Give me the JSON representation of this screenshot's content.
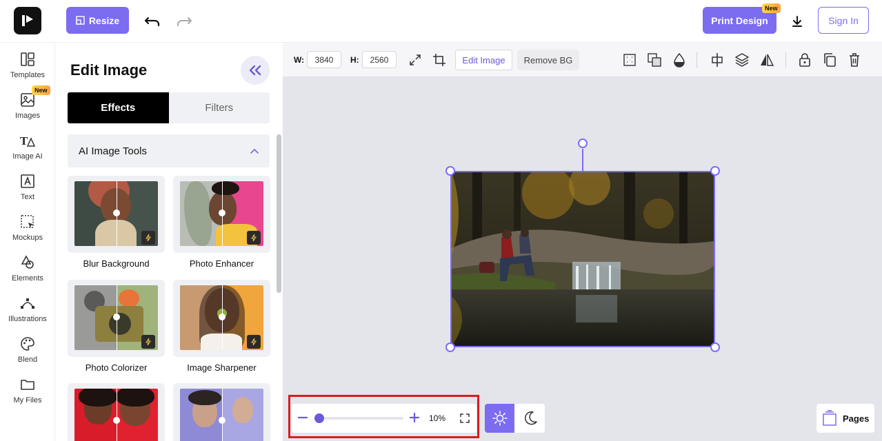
{
  "header": {
    "logo_icon": "brand-logo-icon",
    "resize_label": "Resize",
    "undo_icon": "undo-icon",
    "redo_icon": "redo-icon",
    "print_label": "Print Design",
    "print_badge": "New",
    "download_icon": "download-icon",
    "signin_label": "Sign In",
    "accent_color": "#7c6cf0"
  },
  "rail": {
    "items": [
      {
        "label": "Templates",
        "icon": "templates-icon"
      },
      {
        "label": "Images",
        "icon": "image-icon"
      },
      {
        "label": "Image AI",
        "icon": "image-ai-icon",
        "badge": "New"
      },
      {
        "label": "Text",
        "icon": "text-icon"
      },
      {
        "label": "Mockups",
        "icon": "mockups-icon"
      },
      {
        "label": "Elements",
        "icon": "elements-icon"
      },
      {
        "label": "Illustrations",
        "icon": "illustrations-icon"
      },
      {
        "label": "Blend",
        "icon": "palette-icon"
      },
      {
        "label": "My Files",
        "icon": "folder-icon"
      }
    ]
  },
  "panel": {
    "title": "Edit Image",
    "tabs": [
      {
        "label": "Effects",
        "active": true
      },
      {
        "label": "Filters",
        "active": false
      }
    ],
    "section_title": "AI Image Tools",
    "tools": [
      {
        "label": "Blur Background"
      },
      {
        "label": "Photo Enhancer"
      },
      {
        "label": "Photo Colorizer"
      },
      {
        "label": "Image Sharpener"
      },
      {
        "label": ""
      },
      {
        "label": ""
      }
    ]
  },
  "toolbar": {
    "width_label": "W:",
    "width_value": "3840",
    "height_label": "H:",
    "height_value": "2560",
    "edit_image_label": "Edit Image",
    "remove_bg_label": "Remove BG"
  },
  "zoom": {
    "value_label": "10%",
    "level": 0.1
  },
  "pages": {
    "label": "Pages"
  }
}
